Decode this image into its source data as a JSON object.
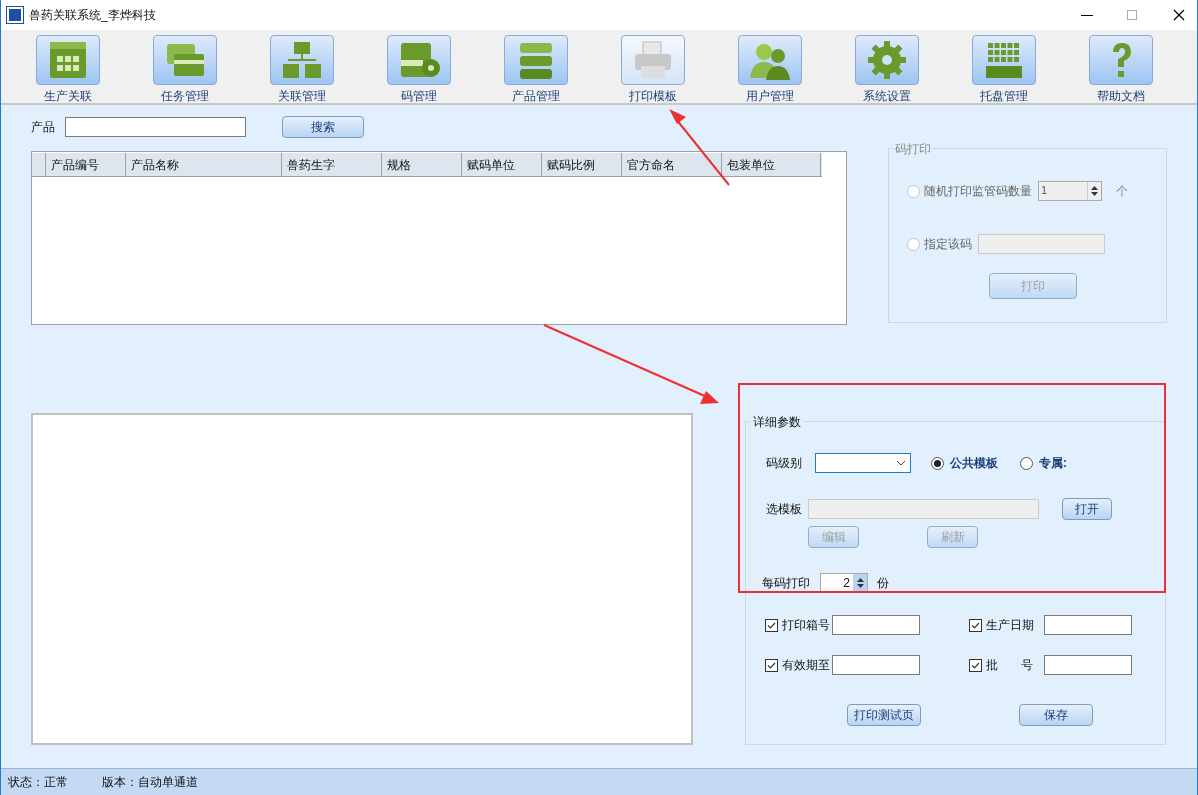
{
  "window": {
    "title": "兽药关联系统_李烨科技"
  },
  "toolbar": [
    {
      "label": "生产关联",
      "disabled": false
    },
    {
      "label": "任务管理",
      "disabled": false
    },
    {
      "label": "关联管理",
      "disabled": false
    },
    {
      "label": "码管理",
      "disabled": false
    },
    {
      "label": "产品管理",
      "disabled": false
    },
    {
      "label": "打印模板",
      "disabled": true
    },
    {
      "label": "用户管理",
      "disabled": false
    },
    {
      "label": "系统设置",
      "disabled": false
    },
    {
      "label": "托盘管理",
      "disabled": false
    },
    {
      "label": "帮助文档",
      "disabled": false
    }
  ],
  "search": {
    "label": "产品",
    "button": "搜索"
  },
  "table": {
    "columns": [
      "产品编号",
      "产品名称",
      "兽药生字",
      "规格",
      "赋码单位",
      "赋码比例",
      "官方命名",
      "包装单位"
    ]
  },
  "code_print": {
    "title": "码打印",
    "disabled": true,
    "options": [
      {
        "label": "随机打印监管码数量",
        "selected": false,
        "value": "1",
        "unit": "个"
      },
      {
        "label": "指定该码",
        "selected": false
      }
    ],
    "button": "打印"
  },
  "details": {
    "title": "详细参数",
    "code_level_label": "码级别",
    "template_options": [
      {
        "label": "公共模板",
        "selected": true
      },
      {
        "label": "专属:",
        "selected": false
      }
    ],
    "template_label": "选模板",
    "open_button": "打开",
    "edit_buttons": [
      {
        "label": "编辑",
        "disabled": true
      },
      {
        "label": "刷新",
        "disabled": true
      }
    ],
    "copies_label": "每码打印",
    "copies": "2",
    "copies_unit": "份",
    "fields": [
      {
        "label": "打印箱号",
        "checked": true
      },
      {
        "label": "生产日期",
        "checked": true
      },
      {
        "label": "有效期至",
        "checked": true
      },
      {
        "label": "批 号",
        "checked": true
      }
    ],
    "buttons": [
      "打印测试页",
      "保存"
    ]
  },
  "status_bar": [
    "状态：正常",
    "版本：自动单通道"
  ]
}
